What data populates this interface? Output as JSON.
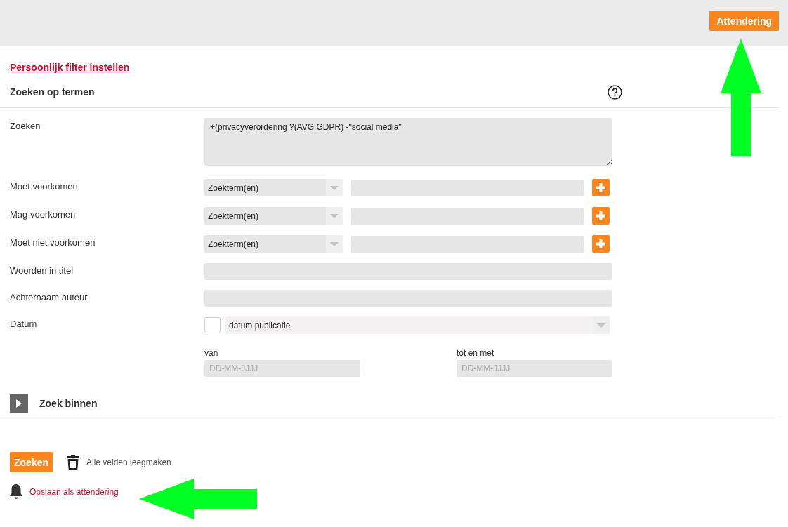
{
  "header": {
    "button": "Attendering"
  },
  "filter_link": "Persoonlijk filter instellen",
  "section": {
    "title": "Zoeken op termen"
  },
  "fields": [
    {
      "kind": "textarea",
      "label": "Zoeken",
      "value": "+(privacyverordering ?(AVG GDPR) -\"social media\""
    },
    {
      "kind": "term",
      "label": "Moet voorkomen",
      "select": "Zoekterm(en)"
    },
    {
      "kind": "term",
      "label": "Mag voorkomen",
      "select": "Zoekterm(en)"
    },
    {
      "kind": "term",
      "label": "Moet niet voorkomen",
      "select": "Zoekterm(en)"
    },
    {
      "kind": "text",
      "label": "Woorden in titel"
    },
    {
      "kind": "text",
      "label": "Achternaam auteur"
    },
    {
      "kind": "date",
      "label": "Datum",
      "checked": false,
      "select": "datum publicatie",
      "from": {
        "label": "van",
        "placeholder": "DD-MM-JJJJ"
      },
      "to": {
        "label": "tot en met",
        "placeholder": "DD-MM-JJJJ"
      }
    }
  ],
  "collapsible": {
    "title": "Zoek binnen",
    "expanded": false
  },
  "actions": {
    "search_button": "Zoeken",
    "clear": "Alle velden leegmaken",
    "save_link": "Opslaan als attendering"
  },
  "annotations": [
    {
      "kind": "uparrow"
    },
    {
      "kind": "leftarrow"
    }
  ]
}
